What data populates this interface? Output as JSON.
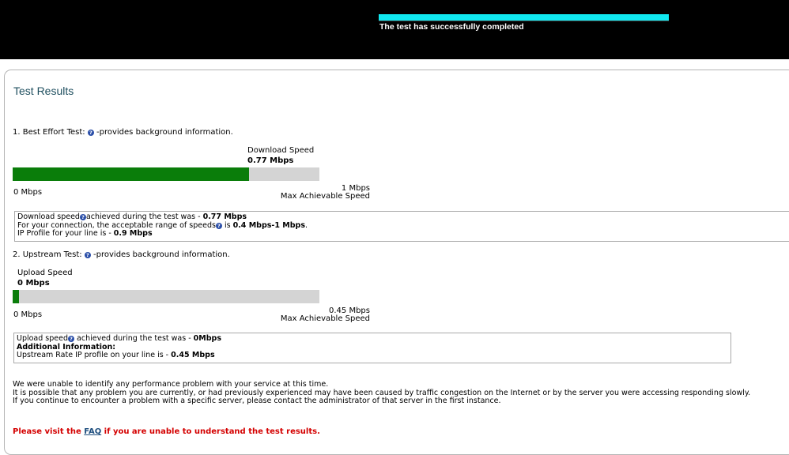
{
  "progress": {
    "fraction": 1.0,
    "status": "The test has successfully completed"
  },
  "panel": {
    "title": "Test Results"
  },
  "best_effort": {
    "heading_prefix": "1. Best Effort Test:",
    "heading_suffix": "-provides background information.",
    "speed_label": "Download  Speed",
    "speed_value": "0.77 Mbps",
    "fraction": 0.77,
    "min_label": "0 Mbps",
    "max_value": "1 Mbps",
    "max_label": "Max Achievable Speed",
    "line1_prefix": "Download speed",
    "line1_mid": "achieved during the test was - ",
    "line1_value": "0.77 Mbps",
    "line2_prefix": "For your connection, the acceptable range of speeds",
    "line2_mid": " is ",
    "line2_value": "0.4 Mbps-1 Mbps",
    "line2_suffix": ".",
    "line3_prefix": "IP Profile for your line is - ",
    "line3_value": "0.9 Mbps"
  },
  "upstream": {
    "heading_prefix": "2. Upstream Test:",
    "heading_suffix": "-provides background information.",
    "speed_label": "Upload Speed",
    "speed_value": "0 Mbps",
    "fraction": 0.02,
    "min_label": "0 Mbps",
    "max_value": "0.45 Mbps",
    "max_label": "Max Achievable Speed",
    "line1_prefix": "Upload speed",
    "line1_mid": " achieved during the test was - ",
    "line1_value": "0Mbps",
    "line2": "Additional Information:",
    "line3_prefix": "Upstream Rate IP profile on your line is - ",
    "line3_value": "0.45 Mbps"
  },
  "summary": {
    "line1": "We were unable to identify any performance problem with your service at this time.",
    "line2": "It is possible that any problem you are currently, or had previously experienced may have been caused by traffic congestion on the Internet or by the server you were accessing responding slowly.",
    "line3": "If you continue to encounter a problem with a specific server, please contact the administrator of that server in the first instance."
  },
  "faq": {
    "prefix": "Please visit the ",
    "link": "FAQ",
    "suffix": " if you are unable to understand the test results."
  },
  "colors": {
    "progress": "#10e8f0",
    "bar_fill": "#0a7d0a",
    "bar_track": "#d4d4d4",
    "title": "#1f4f5f",
    "notice": "#d40000"
  },
  "icons": {
    "help": "question-circle-icon"
  }
}
